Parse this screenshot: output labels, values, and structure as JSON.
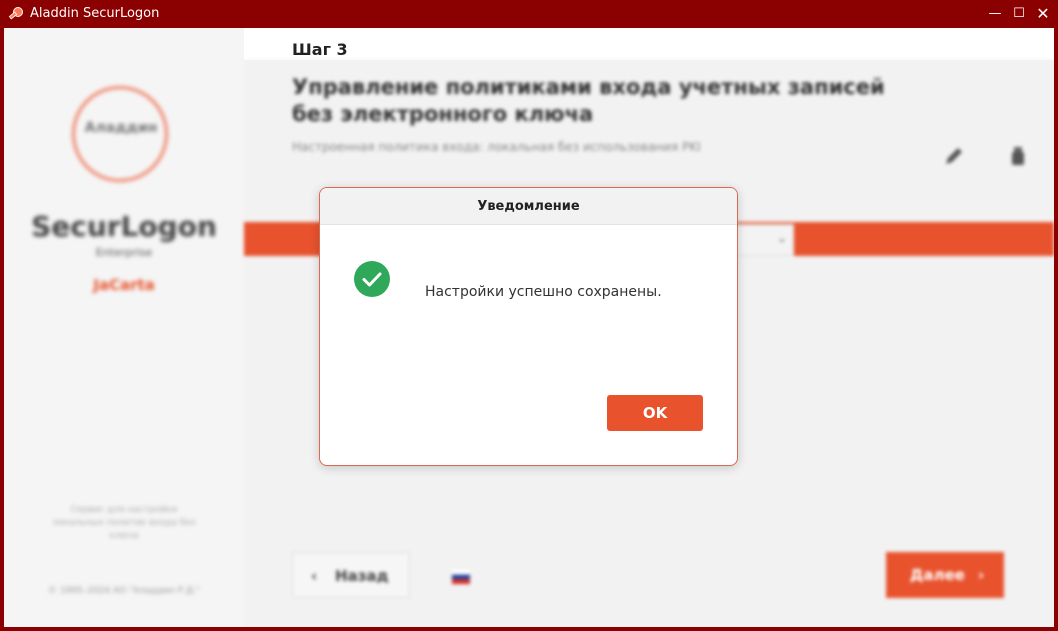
{
  "window": {
    "title": "Aladdin SecurLogon",
    "minimize": "—",
    "maximize": "☐",
    "close": "✕"
  },
  "sidebar": {
    "logo_text": "Аладдин",
    "brand": "SecurLogon",
    "edition": "Enterprise",
    "jacarta": "JaCarta",
    "note": "Сервис для настройки локальных политик входа без ключа",
    "copyright": "© 1995–2024 АО \"Аладдин Р.Д.\""
  },
  "main": {
    "step": "Шаг 3",
    "heading": "Управление политиками входа учетных записей без электронного ключа",
    "subheading": "Настроенная политика входа: локальная без использования PKI",
    "back_label": "Назад",
    "next_label": "Далее"
  },
  "dialog": {
    "title": "Уведомление",
    "message": "Настройки успешно сохранены.",
    "ok_label": "OK"
  },
  "colors": {
    "accent": "#e8532e",
    "titlebar": "#8b0000",
    "success": "#2fa85a"
  }
}
